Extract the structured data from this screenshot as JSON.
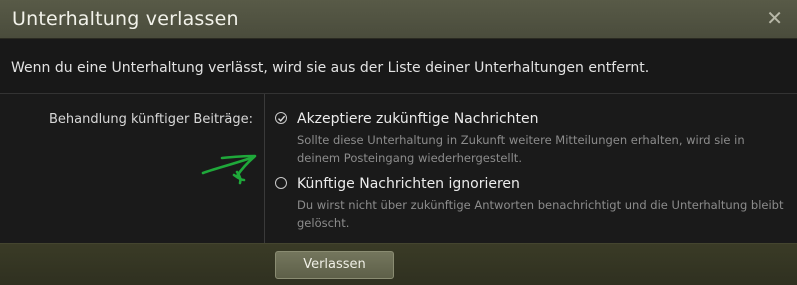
{
  "dialog": {
    "title": "Unterhaltung verlassen",
    "close_icon": "close-icon",
    "close_glyph": "✕",
    "intro": "Wenn du eine Unterhaltung verlässt, wird sie aus der Liste deiner Unterhaltungen entfernt.",
    "field_label": "Behandlung künftiger Beiträge:",
    "options": [
      {
        "label": "Akzeptiere zukünftige Nachrichten",
        "description": "Sollte diese Unterhaltung in Zukunft weitere Mitteilungen erhalten, wird sie in deinem Posteingang wiederhergestellt.",
        "selected": true
      },
      {
        "label": "Künftige Nachrichten ignorieren",
        "description": "Du wirst nicht über zukünftige Antworten benachrichtigt und die Unterhaltung bleibt gelöscht.",
        "selected": false
      }
    ],
    "submit_label": "Verlassen"
  },
  "colors": {
    "titlebar": "#525442",
    "footer": "#353622",
    "annotation_arrow": "#1fa83a"
  }
}
